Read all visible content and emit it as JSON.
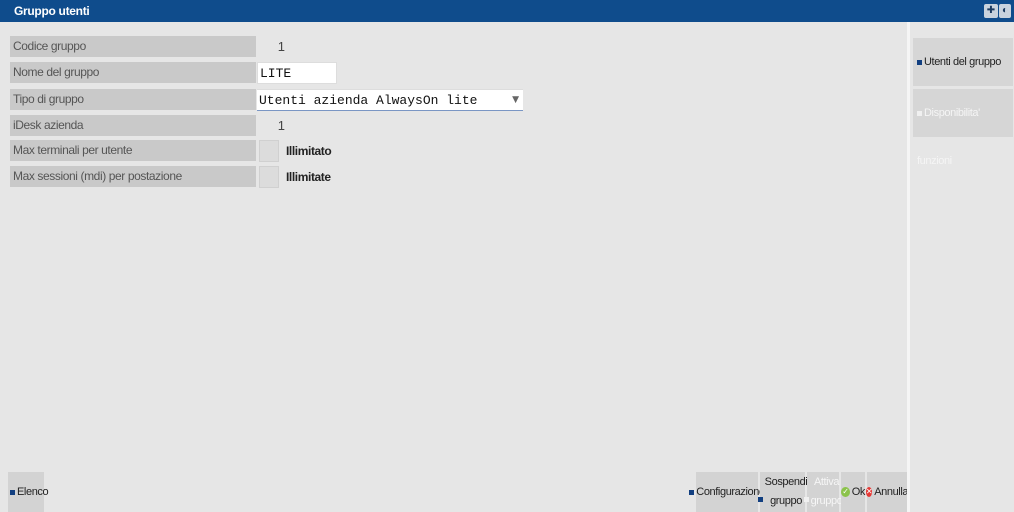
{
  "window": {
    "title": "Gruppo utenti",
    "controls": [
      {
        "icon": "pin-icon",
        "glyph": "✚"
      },
      {
        "icon": "info-icon",
        "glyph": "◐"
      }
    ]
  },
  "form": {
    "fields": [
      {
        "label": "Codice gruppo",
        "value": "1"
      },
      {
        "label": "Nome del gruppo",
        "value": "LITE"
      },
      {
        "label": "Tipo di gruppo",
        "value": "Utenti azienda AlwaysOn lite"
      },
      {
        "label": "iDesk azienda",
        "value": "1"
      },
      {
        "label": "Max terminali per utente",
        "value": "Illimitato"
      },
      {
        "label": "Max sessioni (mdi) per postazione",
        "value": "Illimitate"
      }
    ]
  },
  "sidebar": {
    "buttons": [
      {
        "label": "Utenti del gruppo",
        "enabled": true
      },
      {
        "label": "Disponibilita' funzioni",
        "enabled": false
      }
    ]
  },
  "footer": {
    "elenco": "Elenco",
    "configurazione": "Configurazione",
    "sospendi_line1": "Sospendi",
    "sospendi_line2": "gruppo",
    "attiva_line1": "Attiva",
    "attiva_line2": "gruppo",
    "ok": "Ok",
    "annulla": "Annulla"
  },
  "colors": {
    "title_bar": "#0f4c8c",
    "accent": "#123f80",
    "ok": "#8bc34a",
    "cancel": "#e53935"
  }
}
